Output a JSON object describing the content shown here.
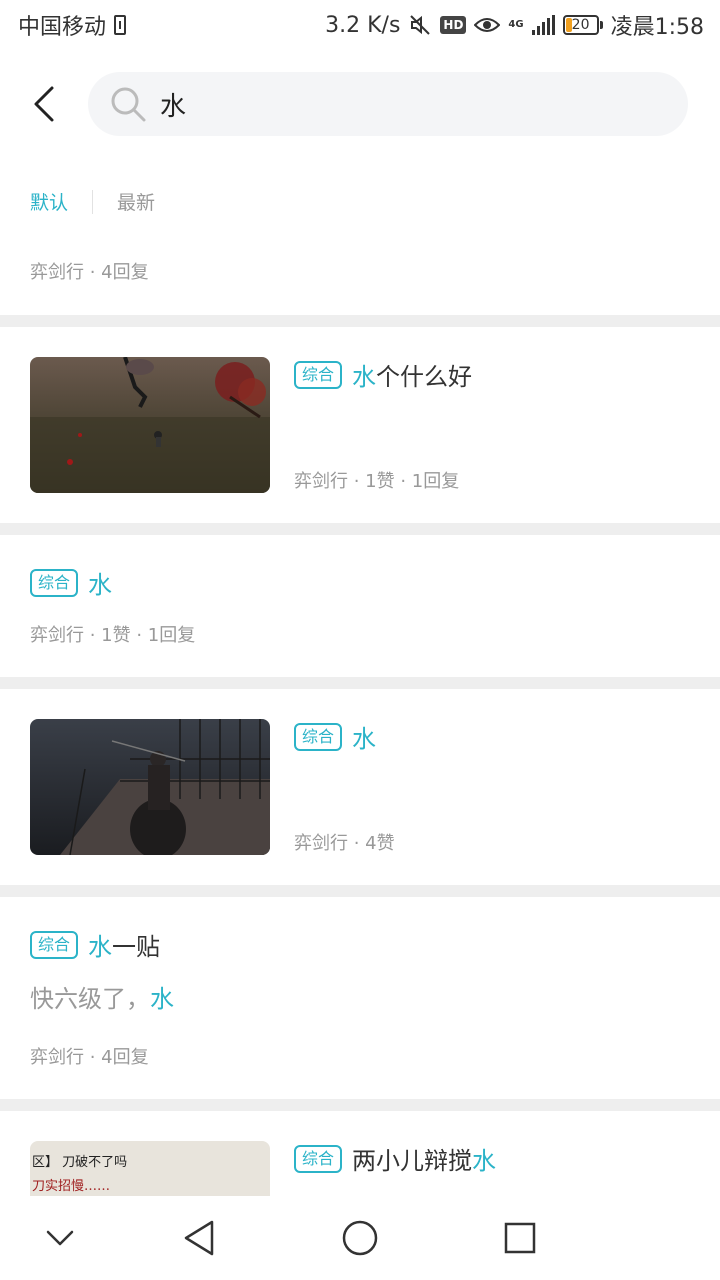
{
  "status_bar": {
    "carrier": "中国移动",
    "speed": "3.2 K/s",
    "hd": "HD",
    "network": "4G",
    "battery": "20",
    "time": "凌晨1:58"
  },
  "search": {
    "query": "水"
  },
  "sort_tabs": {
    "default_label": "默认",
    "latest_label": "最新"
  },
  "first_item": {
    "meta": "弈剑行 · 4回复"
  },
  "results": [
    {
      "tag": "综合",
      "title_highlight": "水",
      "title_rest": "个什么好",
      "meta": "弈剑行 · 1赞 · 1回复"
    },
    {
      "tag": "综合",
      "title_highlight": "水",
      "title_rest": "",
      "meta": "弈剑行 · 1赞 · 1回复"
    },
    {
      "tag": "综合",
      "title_highlight": "水",
      "title_rest": "",
      "meta": "弈剑行 · 4赞"
    },
    {
      "tag": "综合",
      "title_highlight": "水",
      "title_rest": "一贴",
      "excerpt_prefix": "快六级了，",
      "excerpt_highlight": "水",
      "meta": "弈剑行 · 4回复"
    },
    {
      "tag": "综合",
      "title_prefix": "两小儿辩搅",
      "title_highlight": "水",
      "thumb_line1": "区】 刀破不了吗",
      "thumb_line2": "刀实招慢……"
    }
  ],
  "colors": {
    "accent": "#2bb3c8",
    "meta_text": "#999999",
    "divider": "#eeeeee"
  },
  "icons": {
    "back": "chevron-left-icon",
    "search": "search-icon",
    "nav_down": "chevron-down-icon",
    "nav_back": "triangle-back-icon",
    "nav_home": "circle-home-icon",
    "nav_recents": "square-recents-icon"
  }
}
